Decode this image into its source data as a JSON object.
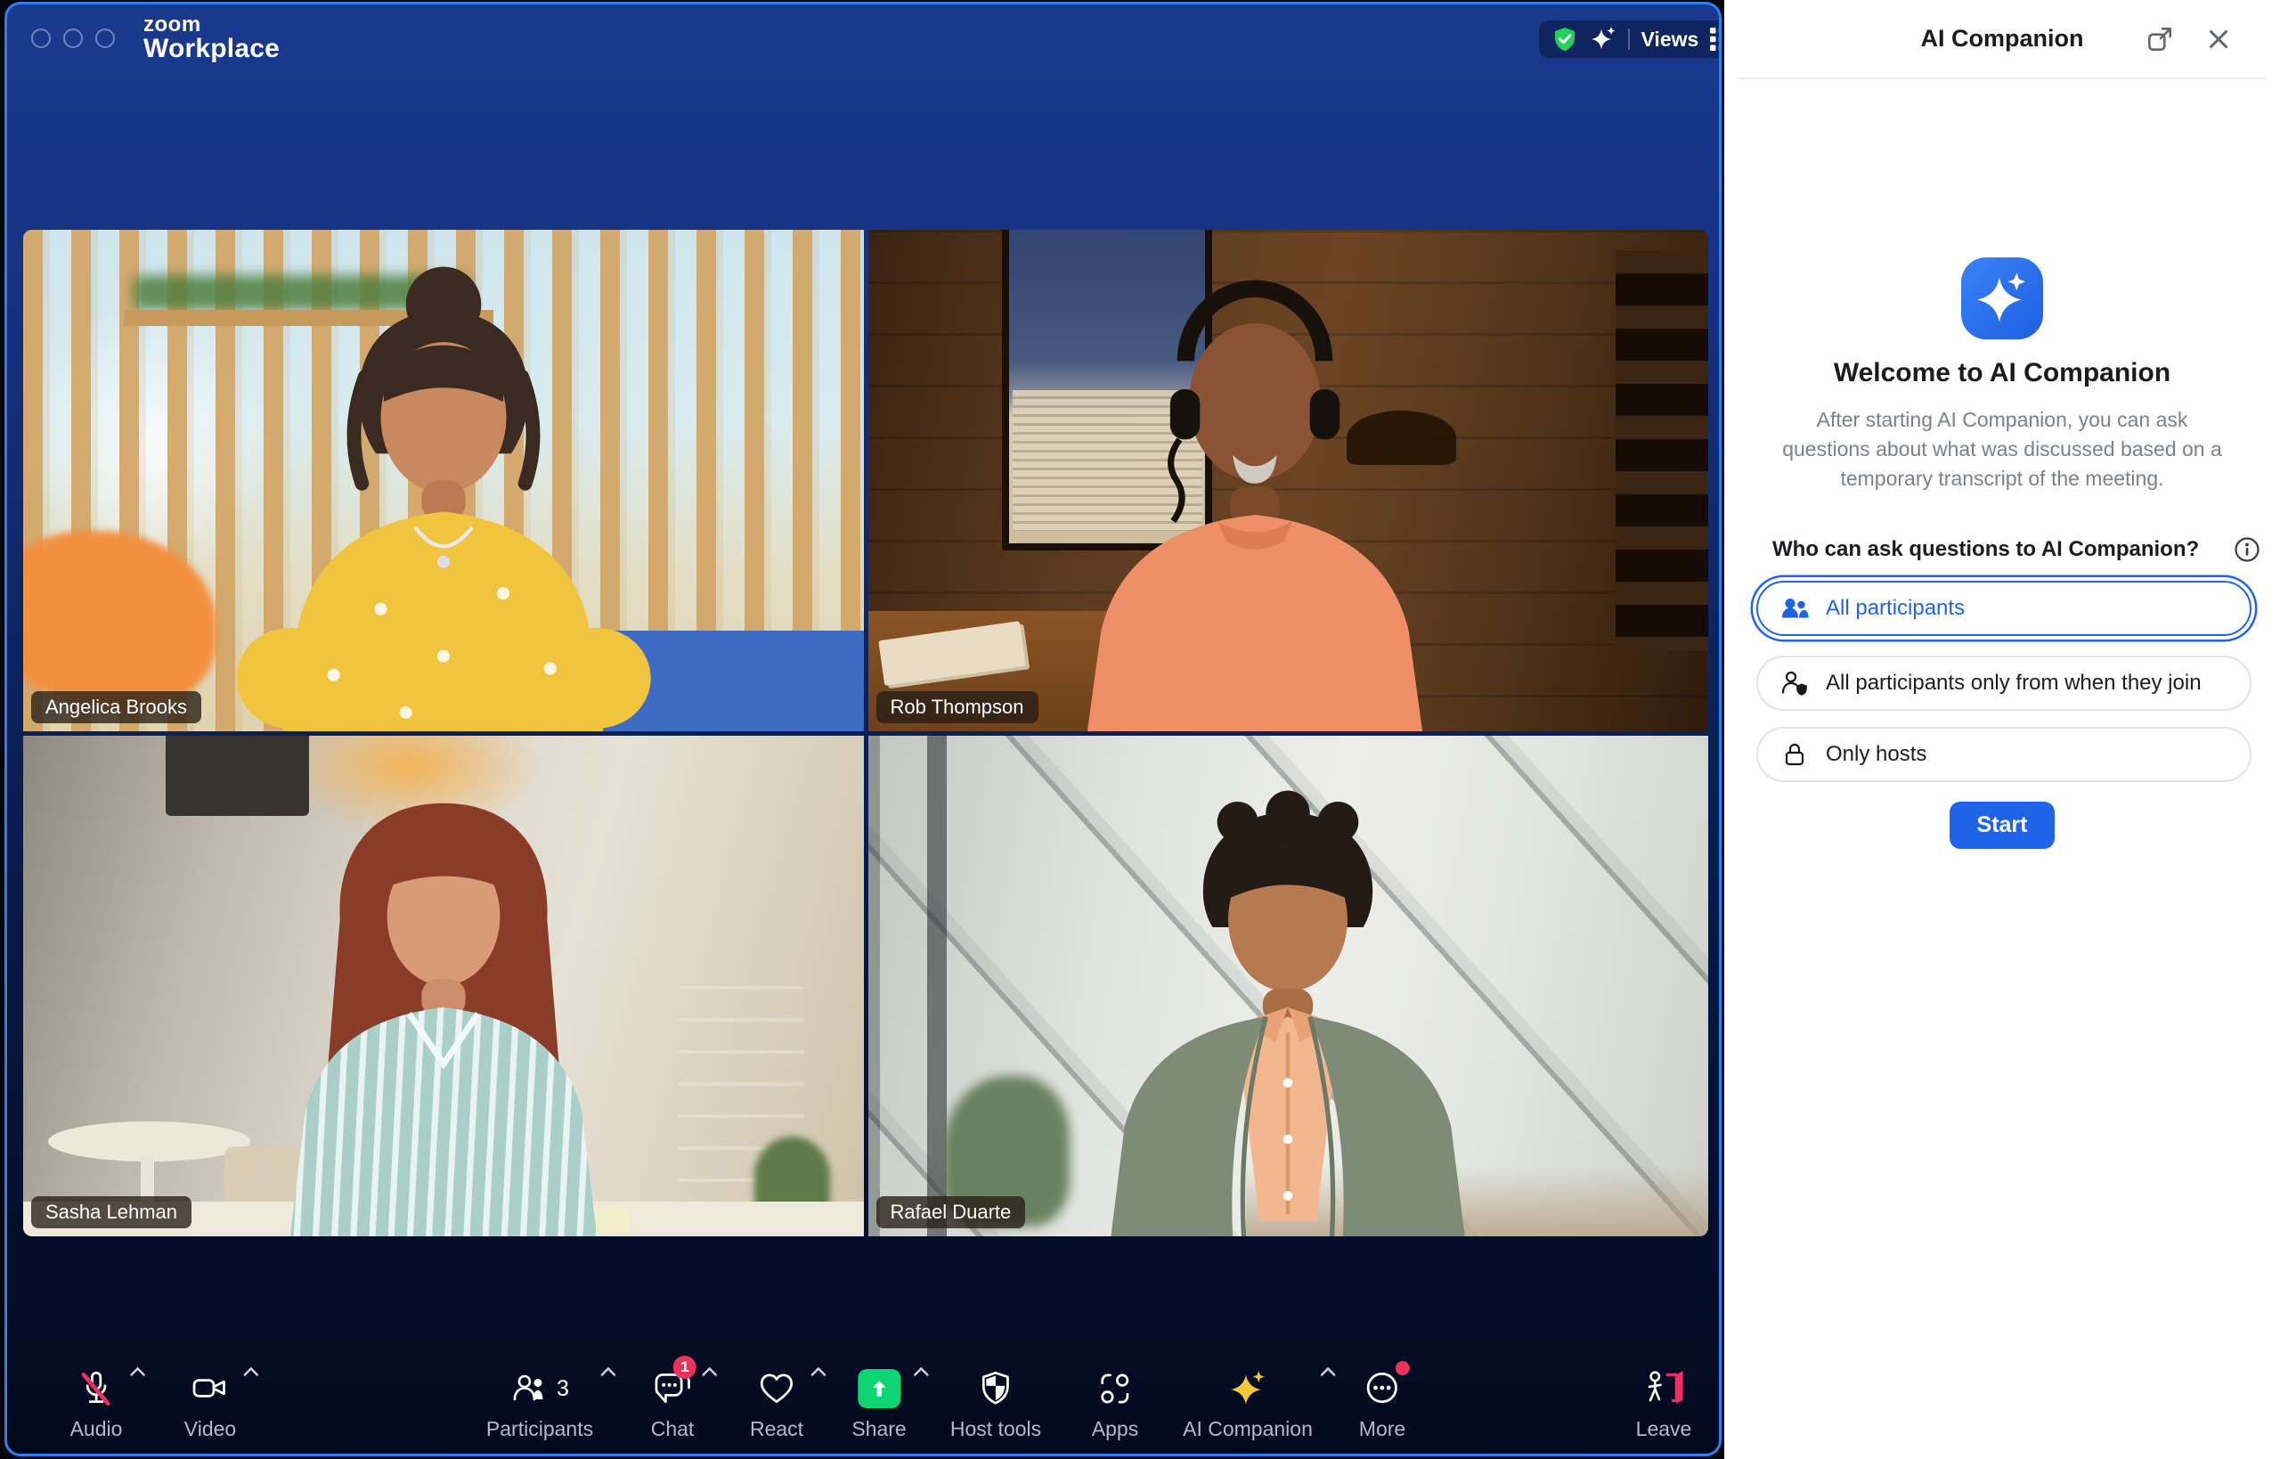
{
  "window": {
    "logo_brand": "zoom",
    "logo_product": "Workplace",
    "views_label": "Views",
    "tiles": [
      {
        "name": "Angelica Brooks"
      },
      {
        "name": "Rob Thompson"
      },
      {
        "name": "Sasha Lehman"
      },
      {
        "name": "Rafael Duarte"
      }
    ],
    "toolbar": {
      "audio": "Audio",
      "video": "Video",
      "participants": "Participants",
      "participants_count": "3",
      "chat": "Chat",
      "chat_badge": "1",
      "react": "React",
      "share": "Share",
      "host_tools": "Host tools",
      "apps": "Apps",
      "ai_companion": "AI Companion",
      "more": "More",
      "leave": "Leave"
    }
  },
  "panel": {
    "title": "AI Companion",
    "welcome_heading": "Welcome to AI Companion",
    "welcome_body": "After starting AI Companion, you can ask questions about what was discussed based on a temporary transcript of the meeting.",
    "question": "Who can ask questions to AI Companion?",
    "options": [
      {
        "label": "All participants",
        "selected": true
      },
      {
        "label": "All participants only from when they join",
        "selected": false
      },
      {
        "label": "Only hosts",
        "selected": false
      }
    ],
    "start_label": "Start"
  },
  "icons": {
    "shield-check-icon": "green shield with white checkmark",
    "sparkle-icon": "four-point AI sparkle",
    "grid-icon": "3x3 gallery view grid",
    "mic-off-icon": "microphone with red slash",
    "camera-icon": "video camera",
    "participants-icon": "two people",
    "chat-icon": "speech bubbles",
    "heart-icon": "heart outline",
    "share-icon": "green square with up arrow",
    "host-tools-icon": "checkered shield",
    "apps-icon": "two circles with corner arcs",
    "ai-companion-icon": "gold sparkle",
    "more-icon": "circle with three dots",
    "leave-icon": "person exiting red door",
    "popout-icon": "open in new window",
    "close-icon": "X",
    "info-icon": "circled i",
    "lock-icon": "padlock"
  },
  "colors": {
    "accent_blue": "#1f64e8",
    "window_border": "#2e7ff0",
    "window_top": "#173383",
    "share_green": "#0ed473",
    "alert_red": "#e8335f",
    "ai_gold": "#f4c63e",
    "shield_green": "#22d05a",
    "panel_bg": "#ffffff"
  }
}
